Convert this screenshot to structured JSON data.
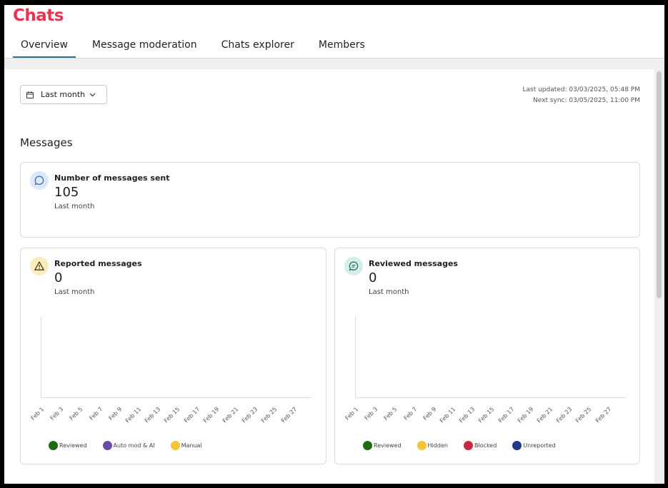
{
  "app": {
    "title": "Chats"
  },
  "tabs": [
    {
      "label": "Overview",
      "active": true
    },
    {
      "label": "Message moderation",
      "active": false
    },
    {
      "label": "Chats explorer",
      "active": false
    },
    {
      "label": "Members",
      "active": false
    }
  ],
  "filter": {
    "label": "Last month",
    "icon": "calendar-icon",
    "chevron": "chevron-down-icon"
  },
  "sync": {
    "last_updated": "Last updated: 03/03/2025, 05:48 PM",
    "next_sync": "Next sync: 03/05/2025, 11:00 PM"
  },
  "messages": {
    "section_title": "Messages",
    "sent": {
      "title": "Number of messages sent",
      "value": "105",
      "period": "Last month",
      "icon": "chat-bubble-icon",
      "icon_bg": "#dbe8f8",
      "icon_color": "#3a6fb0"
    },
    "reported": {
      "title": "Reported messages",
      "value": "0",
      "period": "Last month",
      "icon": "warning-icon",
      "icon_bg": "#fbecc0",
      "icon_color": "#4a3a10"
    },
    "reviewed": {
      "title": "Reviewed messages",
      "value": "0",
      "period": "Last month",
      "icon": "chat-lines-icon",
      "icon_bg": "#d4efe8",
      "icon_color": "#2f6b60"
    }
  },
  "chart_data": [
    {
      "type": "bar",
      "categories": [
        "Feb 1",
        "Feb 3",
        "Feb 5",
        "Feb 7",
        "Feb 9",
        "Feb 11",
        "Feb 13",
        "Feb 15",
        "Feb 17",
        "Feb 19",
        "Feb 21",
        "Feb 23",
        "Feb 25",
        "Feb 27"
      ],
      "series": [
        {
          "name": "Reviewed",
          "color": "#1e6b12",
          "values": [
            0,
            0,
            0,
            0,
            0,
            0,
            0,
            0,
            0,
            0,
            0,
            0,
            0,
            0
          ]
        },
        {
          "name": "Auto mod & AI",
          "color": "#6b4aa8",
          "values": [
            0,
            0,
            0,
            0,
            0,
            0,
            0,
            0,
            0,
            0,
            0,
            0,
            0,
            0
          ]
        },
        {
          "name": "Manual",
          "color": "#f2c43d",
          "values": [
            0,
            0,
            0,
            0,
            0,
            0,
            0,
            0,
            0,
            0,
            0,
            0,
            0,
            0
          ]
        }
      ],
      "legend": "bottom"
    },
    {
      "type": "bar",
      "categories": [
        "Feb 1",
        "Feb 3",
        "Feb 5",
        "Feb 7",
        "Feb 9",
        "Feb 11",
        "Feb 13",
        "Feb 15",
        "Feb 17",
        "Feb 19",
        "Feb 21",
        "Feb 23",
        "Feb 25",
        "Feb 27"
      ],
      "series": [
        {
          "name": "Reviewed",
          "color": "#1e6b12",
          "values": [
            0,
            0,
            0,
            0,
            0,
            0,
            0,
            0,
            0,
            0,
            0,
            0,
            0,
            0
          ]
        },
        {
          "name": "Hidden",
          "color": "#f2c43d",
          "values": [
            0,
            0,
            0,
            0,
            0,
            0,
            0,
            0,
            0,
            0,
            0,
            0,
            0,
            0
          ]
        },
        {
          "name": "Blocked",
          "color": "#c8283c",
          "values": [
            0,
            0,
            0,
            0,
            0,
            0,
            0,
            0,
            0,
            0,
            0,
            0,
            0,
            0
          ]
        },
        {
          "name": "Unreported",
          "color": "#1f3a86",
          "values": [
            0,
            0,
            0,
            0,
            0,
            0,
            0,
            0,
            0,
            0,
            0,
            0,
            0,
            0
          ]
        }
      ],
      "legend": "bottom"
    }
  ]
}
